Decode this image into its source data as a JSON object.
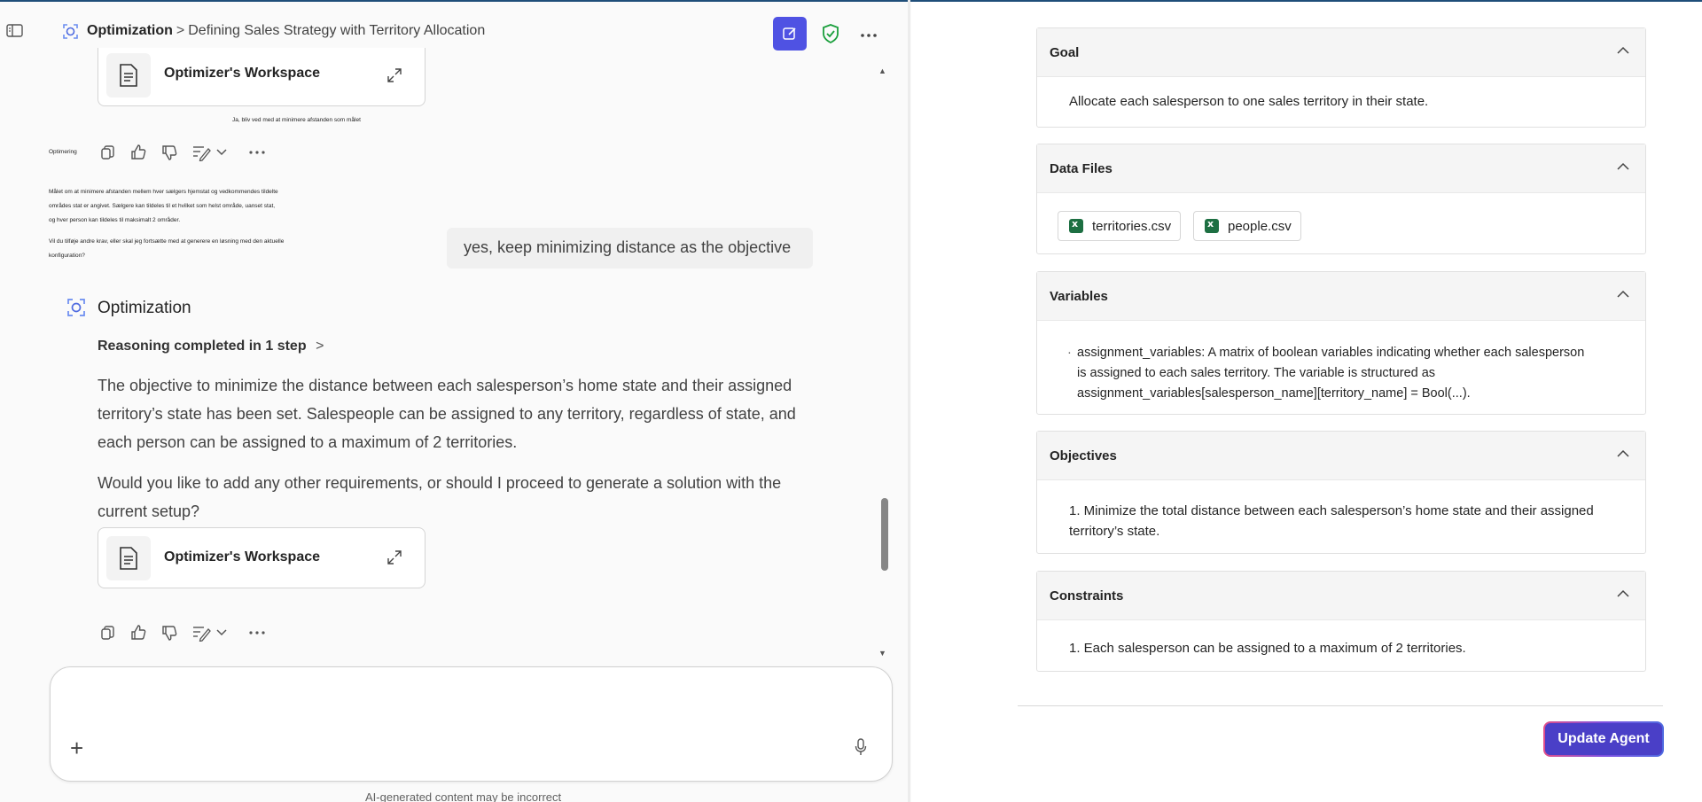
{
  "header": {
    "app_name": "Optimization",
    "separator": ">",
    "conversation_title": "Defining Sales Strategy with Territory Allocation"
  },
  "chat": {
    "workspace_card_label": "Optimizer's Workspace",
    "danish_user_reply": "Ja, bliv ved med at minimere afstanden som målet",
    "danish_bot_name": "Optimering",
    "danish_bot_lines": [
      "Målet om at minimere afstanden mellem hver sælgers hjemstat og vedkommendes tildelte",
      "områdes stat er angivet. Sælgere kan tildeles til et hvilket som helst område, uanset stat,",
      "og hver person kan tildeles til maksimalt 2 områder."
    ],
    "danish_bot_question_lines": [
      "Vil du tilføje andre krav, eller skal jeg fortsætte med at generere en løsning med den aktuelle",
      "konfiguration?"
    ],
    "user_message": "yes, keep minimizing distance as the objective",
    "bot_name": "Optimization",
    "reasoning_label": "Reasoning completed in 1 step",
    "reasoning_chevron": ">",
    "bot_paragraph_1": "The objective to minimize the distance between each salesperson’s home state and their assigned territory’s state has been set. Salespeople can be assigned to any territory, regardless of state, and each person can be assigned to a maximum of 2 territories.",
    "bot_paragraph_2": "Would you like to add any other requirements, or should I proceed to generate a solution with the current setup?"
  },
  "composer": {
    "plus_label": "+",
    "disclaimer": "AI-generated content may be incorrect"
  },
  "panel": {
    "goal": {
      "title": "Goal",
      "text": "Allocate each salesperson to one sales territory in their state."
    },
    "data_files": {
      "title": "Data Files",
      "files": [
        "territories.csv",
        "people.csv"
      ]
    },
    "variables": {
      "title": "Variables",
      "bullet": "·",
      "lines": [
        "assignment_variables: A matrix of boolean variables indicating whether each salesperson",
        "is assigned to each sales territory. The variable is structured as",
        "assignment_variables[salesperson_name][territory_name] = Bool(...)."
      ]
    },
    "objectives": {
      "title": "Objectives",
      "lines": [
        "1. Minimize the total distance between each salesperson’s home state and their assigned",
        "territory’s state."
      ]
    },
    "constraints": {
      "title": "Constraints",
      "text": "1. Each salesperson can be assigned to a maximum of 2 territories."
    },
    "update_button": "Update Agent"
  },
  "colors": {
    "accent": "#4f52e3",
    "shield": "#1a9f3c",
    "excel": "#1d6f42",
    "button": "#4a3fc7"
  },
  "icons": [
    "sidebar-toggle-icon",
    "optimization-icon",
    "edit-icon",
    "shield-check-icon",
    "more-icon",
    "workspace-doc-icon",
    "expand-icon",
    "copy-icon",
    "thumbs-up-icon",
    "thumbs-down-icon",
    "rewrite-icon",
    "chevron-down-icon",
    "plus-icon",
    "mic-icon",
    "chevron-up-icon",
    "excel-file-icon"
  ]
}
